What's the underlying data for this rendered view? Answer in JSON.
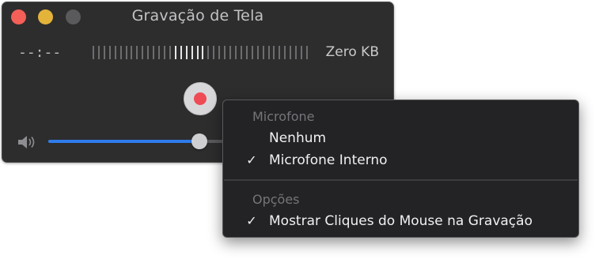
{
  "window": {
    "title": "Gravação de Tela",
    "timer": "--:--",
    "file_size": "Zero KB",
    "level_meter": {
      "bars": 40,
      "highlighted_range": [
        15,
        20
      ]
    },
    "volume_level_percent": 85,
    "icons": {
      "record": "record-icon",
      "speaker": "speaker-icon"
    }
  },
  "menu": {
    "section_microphone": "Microfone",
    "items_microphone": [
      {
        "label": "Nenhum",
        "checked": false
      },
      {
        "label": "Microfone Interno",
        "checked": true
      }
    ],
    "section_options": "Opções",
    "items_options": [
      {
        "label": "Mostrar Cliques do Mouse na Gravação",
        "checked": true
      }
    ],
    "check_glyph": "✓"
  },
  "colors": {
    "close": "#f45f58",
    "minimize": "#e4b33a",
    "zoom_disabled": "#5a5a5d",
    "record_dot": "#ee4b55",
    "slider_accent": "#2f7bea"
  }
}
